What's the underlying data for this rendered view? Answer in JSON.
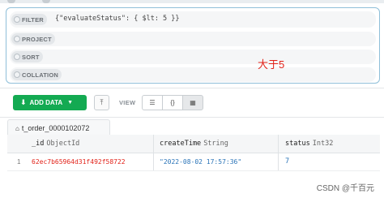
{
  "query_bar": {
    "filter": {
      "label": "FILTER",
      "value": "{\"evaluateStatus\": { $lt: 5 }}"
    },
    "project": {
      "label": "PROJECT"
    },
    "sort": {
      "label": "SORT"
    },
    "collation": {
      "label": "COLLATION"
    },
    "annotation": "大于5"
  },
  "toolbar": {
    "add_data_label": "ADD DATA",
    "view_label": "VIEW",
    "active_view": "table"
  },
  "collection_tab": {
    "name": "t_order_0000102072"
  },
  "table": {
    "columns": [
      {
        "name": "_id",
        "type": "ObjectId"
      },
      {
        "name": "createTime",
        "type": "String"
      },
      {
        "name": "status",
        "type": "Int32"
      }
    ],
    "rows": [
      {
        "index": "1",
        "id": "62ec7b65964d31f492f58722",
        "createTime": "\"2022-08-02 17:57:36\"",
        "status": "7"
      }
    ]
  },
  "watermark": "CSDN @千百元",
  "colors": {
    "accent_green": "#13aa52",
    "annotation_red": "#e2231a",
    "value_blue": "#2a74b8",
    "panel_border": "#8fbfd9"
  },
  "icons": [
    "download-icon",
    "caret-down-icon",
    "export-icon",
    "list-view-icon",
    "json-view-icon",
    "table-view-icon",
    "house-icon"
  ]
}
